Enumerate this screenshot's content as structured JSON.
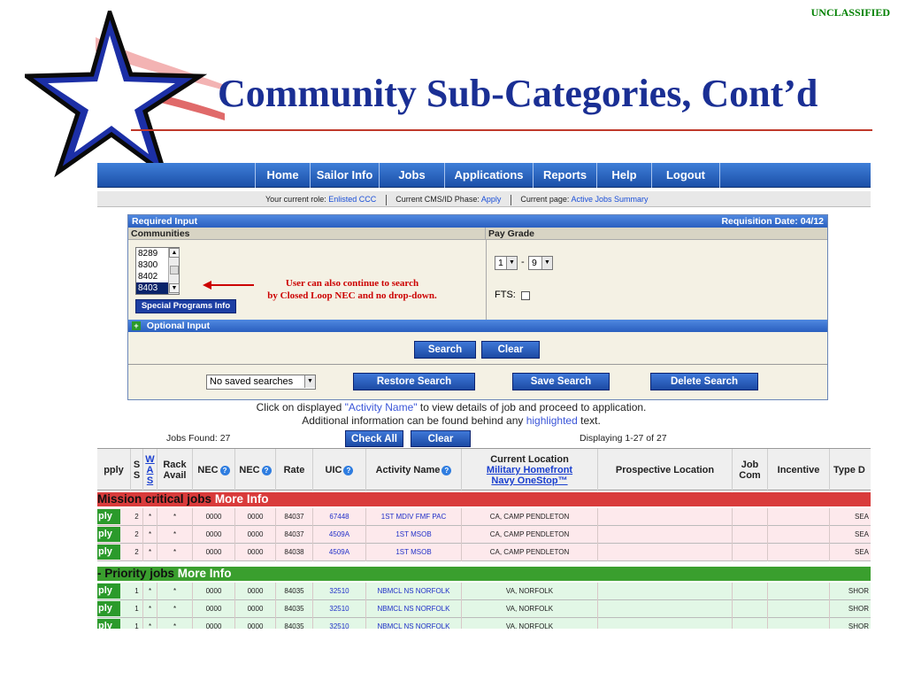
{
  "slide": {
    "classification": "UNCLASSIFIED",
    "title": "Community Sub-Categories, Cont’d"
  },
  "colors": {
    "title_blue": "#1a2f94",
    "accent_red": "#c0392b",
    "nav_blue": "#2a5fbf",
    "mission_red": "#d93b3b",
    "priority_green": "#3a9f2e",
    "row_pink": "#fde9ec",
    "row_green": "#e2f7e6"
  },
  "nav": {
    "items": [
      "Home",
      "Sailor Info",
      "Jobs",
      "Applications",
      "Reports",
      "Help",
      "Logout"
    ]
  },
  "status": {
    "role_label": "Your current role:",
    "role_value": "Enlisted CCC",
    "phase_label": "Current CMS/ID Phase:",
    "phase_value": "Apply",
    "page_label": "Current page:",
    "page_value": "Active Jobs Summary"
  },
  "required": {
    "header": "Required Input",
    "requisition_date": "Requisition Date: 04/12",
    "communities_label": "Communities",
    "communities": [
      "8289",
      "8300",
      "8402",
      "8403"
    ],
    "selected_community": "8403",
    "special_programs_label": "Special Programs Info",
    "pay_grade_label": "Pay Grade",
    "pay_grade_from": "1",
    "pay_grade_sep": "-",
    "pay_grade_to": "9",
    "fts_label": "FTS:",
    "annotation_line1": "User can also continue to search",
    "annotation_line2": "by Closed Loop NEC and no drop-down.",
    "optional_label": "Optional Input",
    "search_label": "Search",
    "clear_label": "Clear",
    "saved_searches": "No saved searches",
    "restore_label": "Restore Search",
    "save_label": "Save Search",
    "delete_label": "Delete Search"
  },
  "info": {
    "line1_pre": "Click on displayed ",
    "line1_hl": "\"Activity Name\"",
    "line1_post": " to view details of job and proceed to application.",
    "line2_pre": "Additional information can be found behind any ",
    "line2_hl": "highlighted",
    "line2_post": " text."
  },
  "jobs": {
    "found": "Jobs Found: 27",
    "check_all": "Check All",
    "clear": "Clear",
    "displaying": "Displaying 1-27 of 27"
  },
  "table": {
    "headers": {
      "apply": "pply",
      "ss": "S S",
      "was": "W A S",
      "rack": "Rack Avail",
      "nec1": "NEC",
      "nec2": "NEC",
      "rate": "Rate",
      "uic": "UIC",
      "activity": "Activity Name",
      "current_loc": "Current Location",
      "current_loc_link1": "Military Homefront",
      "current_loc_link2": "Navy OneStop™",
      "prospective": "Prospective Location",
      "job_com": "Job Com",
      "incentive": "Incentive",
      "type": "Type D"
    },
    "mission_label": "Mission critical jobs",
    "mission_more": "More Info",
    "priority_label": "- Priority jobs",
    "priority_more": "More Info",
    "apply_text": "ply",
    "mission_rows": [
      {
        "ss": "2",
        "was": "*",
        "rack": "*",
        "nec1": "0000",
        "nec2": "0000",
        "rate": "84037",
        "uic": "67448",
        "activity": "1ST MDIV FMF PAC",
        "location": "CA, CAMP PENDLETON",
        "type": "SEA"
      },
      {
        "ss": "2",
        "was": "*",
        "rack": "*",
        "nec1": "0000",
        "nec2": "0000",
        "rate": "84037",
        "uic": "4509A",
        "activity": "1ST MSOB",
        "location": "CA, CAMP PENDLETON",
        "type": "SEA"
      },
      {
        "ss": "2",
        "was": "*",
        "rack": "*",
        "nec1": "0000",
        "nec2": "0000",
        "rate": "84038",
        "uic": "4509A",
        "activity": "1ST MSOB",
        "location": "CA, CAMP PENDLETON",
        "type": "SEA"
      }
    ],
    "priority_rows": [
      {
        "ss": "1",
        "was": "*",
        "rack": "*",
        "nec1": "0000",
        "nec2": "0000",
        "rate": "84035",
        "uic": "32510",
        "activity": "NBMCL NS NORFOLK",
        "location": "VA, NORFOLK",
        "type": "SHOR"
      },
      {
        "ss": "1",
        "was": "*",
        "rack": "*",
        "nec1": "0000",
        "nec2": "0000",
        "rate": "84035",
        "uic": "32510",
        "activity": "NBMCL NS NORFOLK",
        "location": "VA, NORFOLK",
        "type": "SHOR"
      },
      {
        "ss": "1",
        "was": "*",
        "rack": "*",
        "nec1": "0000",
        "nec2": "0000",
        "rate": "84035",
        "uic": "32510",
        "activity": "NBMCL NS NORFOLK",
        "location": "VA, NORFOLK",
        "type": "SHOR"
      }
    ]
  }
}
